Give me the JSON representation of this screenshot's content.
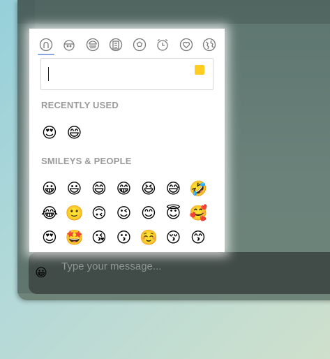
{
  "composer": {
    "placeholder": "Type your message...",
    "emoji_button": "😀"
  },
  "picker": {
    "categories": [
      {
        "name": "people",
        "icon": "person-icon",
        "active": true
      },
      {
        "name": "nature",
        "icon": "bear-icon"
      },
      {
        "name": "food",
        "icon": "burger-icon"
      },
      {
        "name": "places",
        "icon": "building-icon"
      },
      {
        "name": "activity",
        "icon": "ball-icon"
      },
      {
        "name": "objects",
        "icon": "alarm-clock-icon"
      },
      {
        "name": "symbols",
        "icon": "heart-icon"
      },
      {
        "name": "flags",
        "icon": "globe-icon"
      }
    ],
    "search": {
      "value": "",
      "skin_tone_color": "#ffcc22"
    },
    "recent": {
      "title": "RECENTLY USED",
      "emojis": [
        "😍",
        "😄"
      ]
    },
    "smileys": {
      "title": "SMILEYS & PEOPLE",
      "emojis": [
        "😀",
        "😃",
        "😄",
        "😁",
        "😆",
        "😅",
        "🤣",
        "😂",
        "🙂",
        "🙃",
        "😉",
        "😊",
        "😇",
        "🥰",
        "😍",
        "🤩",
        "😘",
        "😗",
        "☺️",
        "😚",
        "😙"
      ]
    }
  }
}
